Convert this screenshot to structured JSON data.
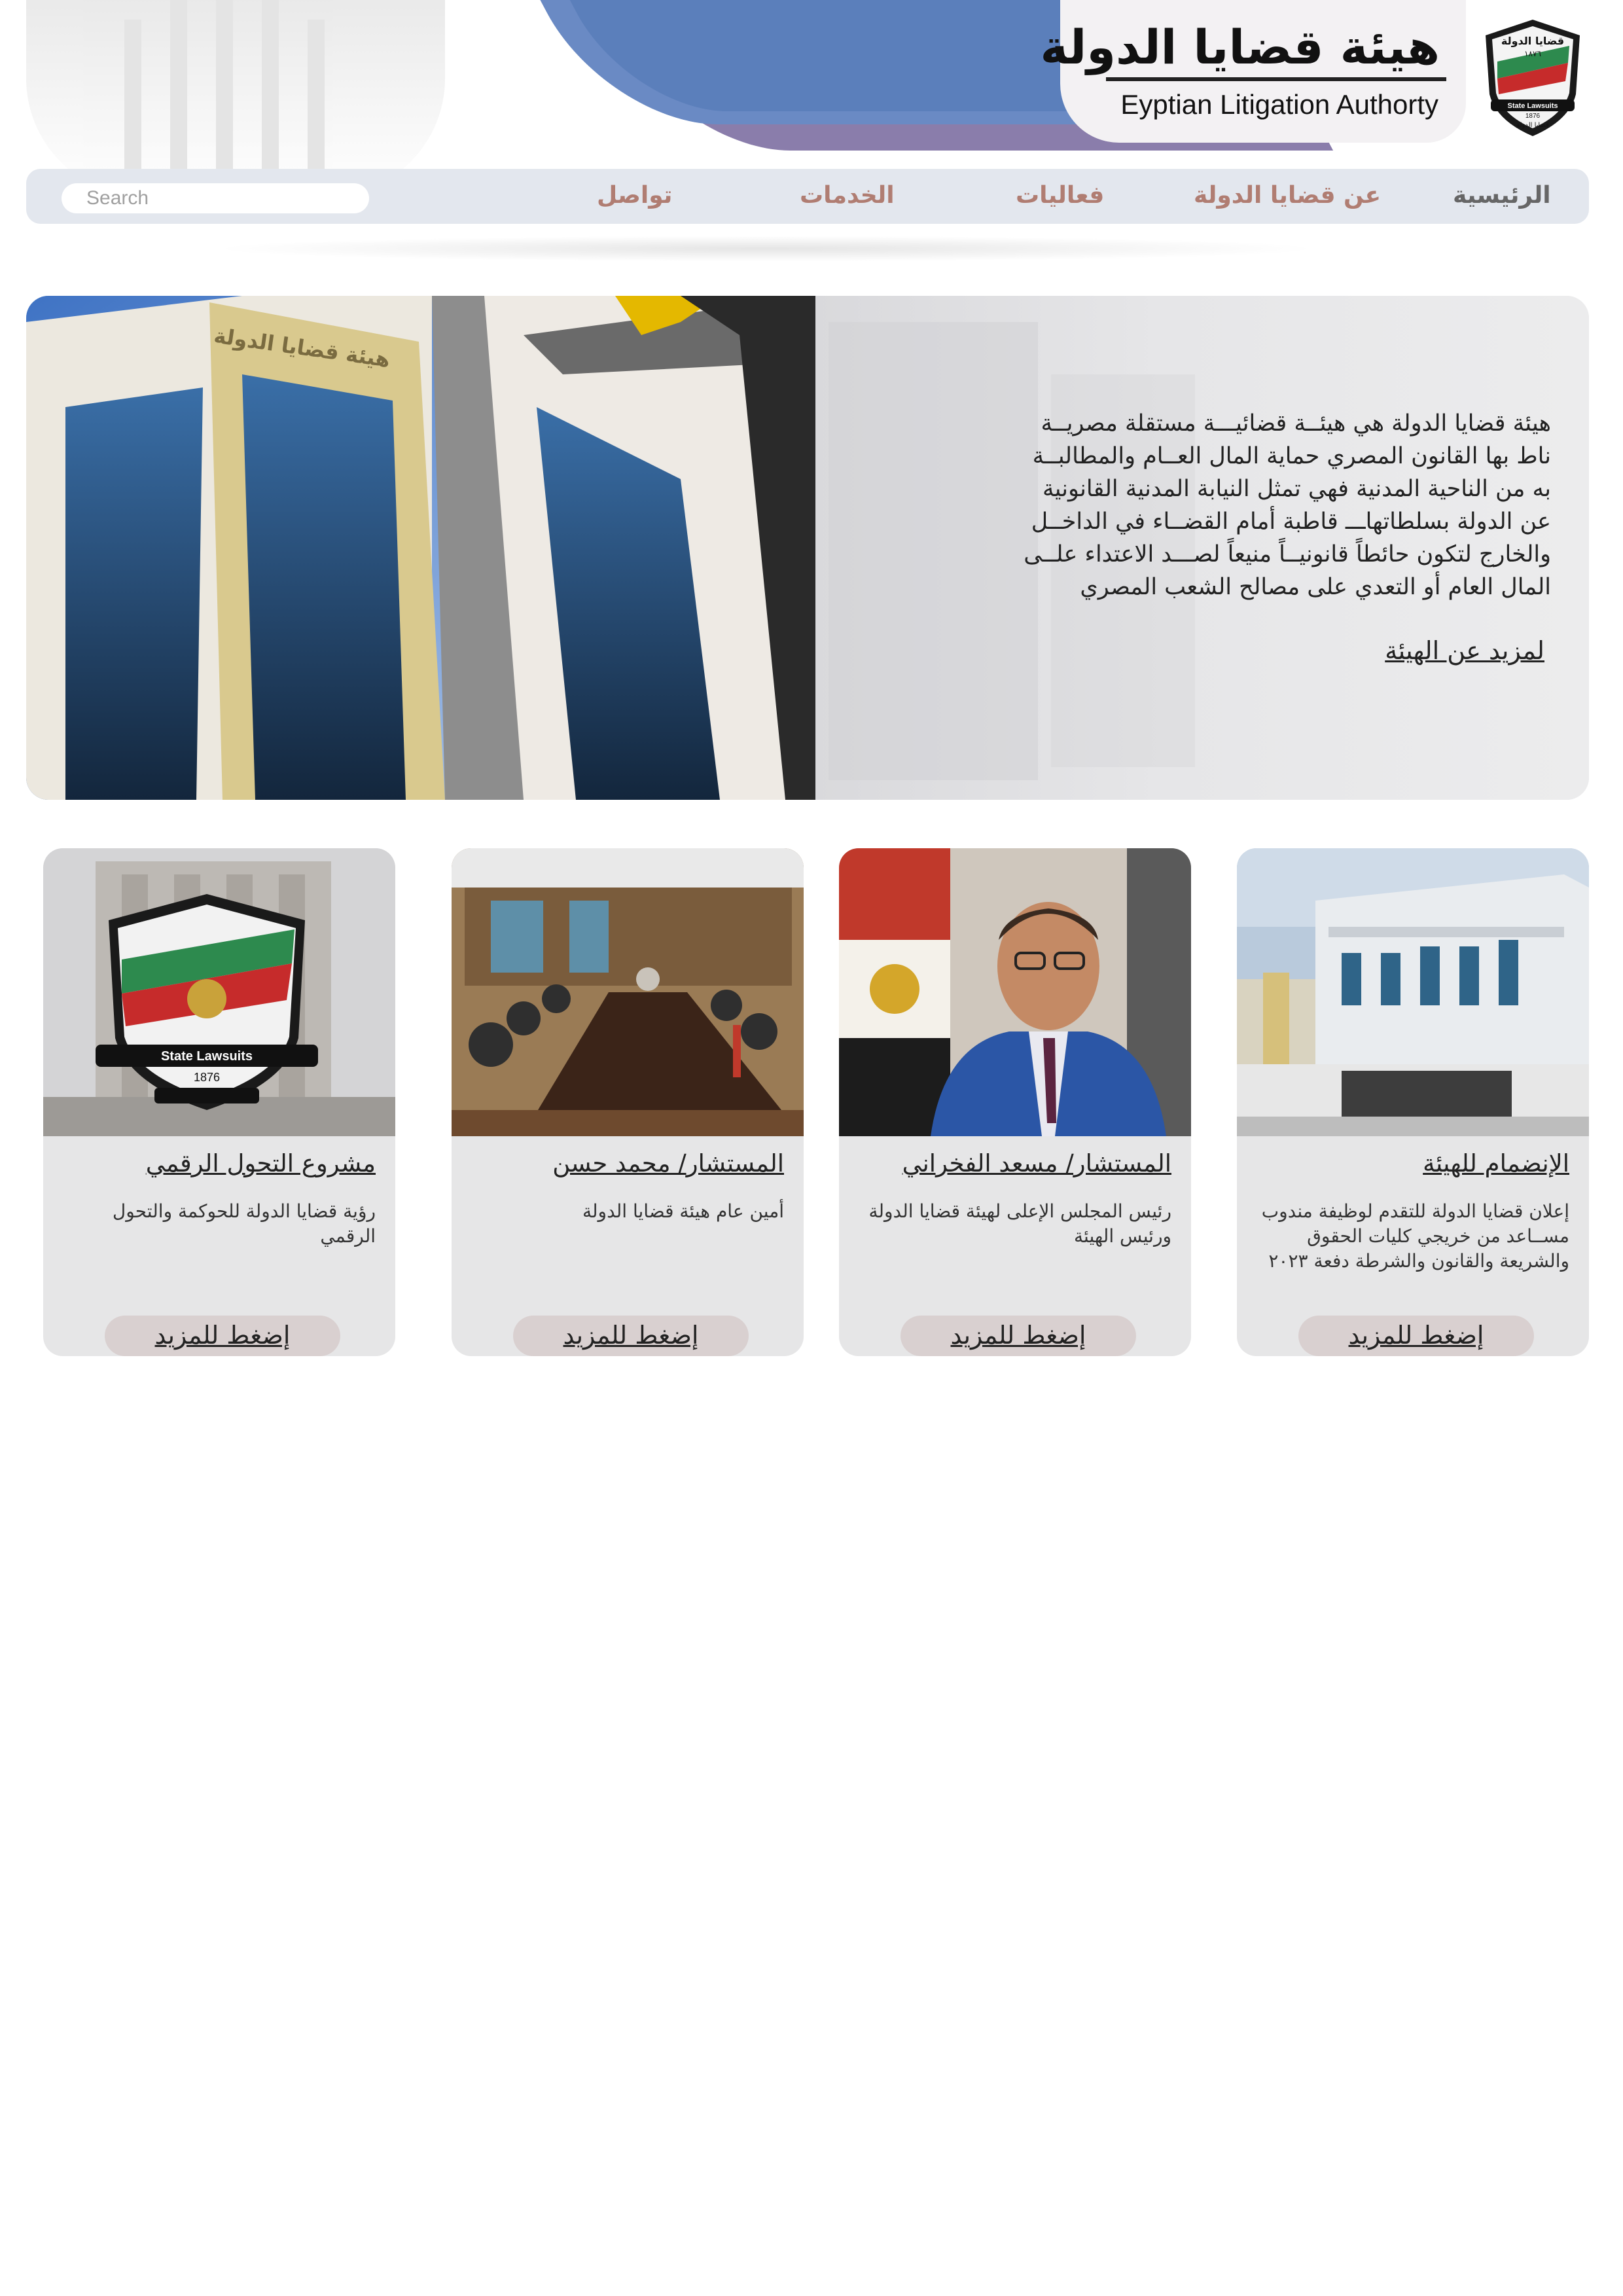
{
  "header": {
    "title_ar": "هيئة قضايا الدولة",
    "title_en": "Eyptian Litigation Authorty",
    "logo": {
      "icon": "state-lawsuits-shield-icon",
      "text_top": "قضايا الدولة",
      "year_ar": "١٨٧٦",
      "ribbon": "State Lawsuits",
      "year": "1876",
      "text_bottom": "قضايا الدولة"
    }
  },
  "nav": {
    "items": [
      {
        "label": "الرئيسية"
      },
      {
        "label": "عن قضايا الدولة"
      },
      {
        "label": "فعاليات"
      },
      {
        "label": "الخدمات"
      },
      {
        "label": "تواصل"
      }
    ],
    "search_placeholder": "Search"
  },
  "hero": {
    "photo_sign": "هيئة قضايا الدولة",
    "lines": [
      "هيئة قضايا الدولة هي هيئــة قضائيـــة مستقلة مصريــة",
      "ناط بها القانون المصري حماية المال العــام  والمطالبــة",
      "به من الناحية المدنية فهي تمثل النيابة المدنية القانونية",
      "عن الدولة بسلطاتهاـــ قاطبة أمام القضــاء في الداخــل",
      "والخارج لتكون حائطاً قانونيــاً منيعاً لصـــد الاعتداء علــى",
      "المال العام أو التعدي على مصالح الشعب المصري"
    ],
    "link": "لمزيد عن الهيئة"
  },
  "cards": [
    {
      "title": "الإنضمام للهيئة",
      "desc": "إعلان قضايا الدولة للتقدم لوظيفة مندوب مســاعد من خريجي كليات الحقوق والشريعة والقانون  والشرطة دفعة ٢٠٢٣",
      "button": "إضغط للمزيد"
    },
    {
      "title": "المستشار/ مسعد الفخراني",
      "desc": "رئيس المجلس الإعلى لهيئة قضايا الدولة ورئيس الهيئة",
      "button": "إضغط للمزيد"
    },
    {
      "title": "المستشار/ محمد حسن",
      "desc": "أمين عام هيئة قضايا الدولة",
      "button": "إضغط للمزيد"
    },
    {
      "title": "مشروع التحول الرقمي",
      "desc": "رؤية قضايا الدولة للحوكمة والتحول الرقمي",
      "button": "إضغط للمزيد",
      "logo_ribbon": "State Lawsuits",
      "logo_year": "1876"
    }
  ],
  "colors": {
    "nav_bg": "#e3e7ee",
    "nav_text": "#b07d72",
    "nav_home_text": "#666666",
    "card_bg": "#e6e6e7",
    "button_bg": "#d9d0d0",
    "band_blue": "#5b7fbb",
    "band_purple": "#7d6fa2"
  }
}
